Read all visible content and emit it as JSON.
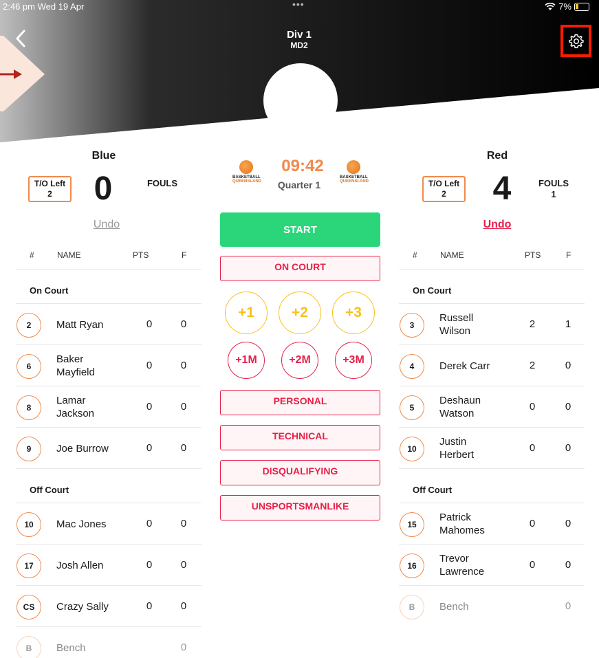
{
  "status": {
    "time": "2:46 pm  Wed 19 Apr",
    "dots": "•••",
    "battery": "7%"
  },
  "header": {
    "title": "Div 1",
    "subtitle": "MD2",
    "back_icon": "chevron-left-icon",
    "settings_icon": "gear-icon"
  },
  "center": {
    "clock": "09:42",
    "quarter": "Quarter 1",
    "logo_text_1": "BASKETBALL",
    "logo_text_2": "QUEENSLAND",
    "start": "START",
    "on_court": "ON COURT",
    "points": [
      "+1",
      "+2",
      "+3"
    ],
    "misses": [
      "+1M",
      "+2M",
      "+3M"
    ],
    "fouls": [
      "PERSONAL",
      "TECHNICAL",
      "DISQUALIFYING",
      "UNSPORTSMANLIKE"
    ]
  },
  "home": {
    "name": "Blue",
    "to_label": "T/O Left",
    "to_value": "2",
    "score": "0",
    "fouls_label": "FOULS",
    "fouls_value": "",
    "undo": "Undo",
    "columns": [
      "#",
      "NAME",
      "PTS",
      "F"
    ],
    "on_court_label": "On Court",
    "off_court_label": "Off Court",
    "on_court": [
      {
        "num": "2",
        "name": "Matt Ryan",
        "pts": "0",
        "f": "0"
      },
      {
        "num": "6",
        "name": "Baker\nMayfield",
        "pts": "0",
        "f": "0"
      },
      {
        "num": "8",
        "name": "Lamar\nJackson",
        "pts": "0",
        "f": "0"
      },
      {
        "num": "9",
        "name": "Joe Burrow",
        "pts": "0",
        "f": "0"
      }
    ],
    "off_court": [
      {
        "num": "10",
        "name": "Mac Jones",
        "pts": "0",
        "f": "0"
      },
      {
        "num": "17",
        "name": "Josh Allen",
        "pts": "0",
        "f": "0"
      },
      {
        "num": "CS",
        "name": "Crazy Sally",
        "pts": "0",
        "f": "0"
      },
      {
        "num": "B",
        "name": "Bench",
        "pts": "",
        "f": "0"
      }
    ]
  },
  "away": {
    "name": "Red",
    "to_label": "T/O Left",
    "to_value": "2",
    "score": "4",
    "fouls_label": "FOULS",
    "fouls_value": "1",
    "undo": "Undo",
    "columns": [
      "#",
      "NAME",
      "PTS",
      "F"
    ],
    "on_court_label": "On Court",
    "off_court_label": "Off Court",
    "on_court": [
      {
        "num": "3",
        "name": "Russell\nWilson",
        "pts": "2",
        "f": "1"
      },
      {
        "num": "4",
        "name": "Derek Carr",
        "pts": "2",
        "f": "0"
      },
      {
        "num": "5",
        "name": "Deshaun\nWatson",
        "pts": "0",
        "f": "0"
      },
      {
        "num": "10",
        "name": "Justin\nHerbert",
        "pts": "0",
        "f": "0"
      }
    ],
    "off_court": [
      {
        "num": "15",
        "name": "Patrick\nMahomes",
        "pts": "0",
        "f": "0"
      },
      {
        "num": "16",
        "name": "Trevor\nLawrence",
        "pts": "0",
        "f": "0"
      },
      {
        "num": "B",
        "name": "Bench",
        "pts": "",
        "f": "0"
      }
    ]
  },
  "colors": {
    "accent_orange": "#f08a4b",
    "start_green": "#2bd67b",
    "foul_red": "#e8204a",
    "points_yellow": "#f6c21b",
    "highlight_red": "#ff1a00"
  }
}
